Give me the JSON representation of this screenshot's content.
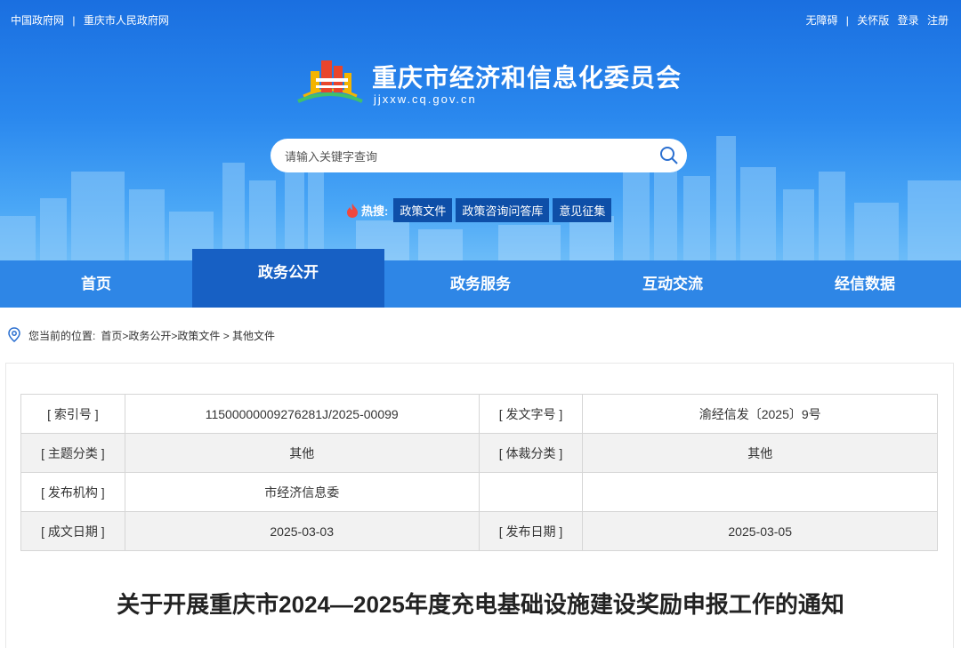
{
  "top": {
    "links": [
      "中国政府网",
      "重庆市人民政府网"
    ],
    "right_links": [
      "无障碍",
      "关怀版",
      "登录",
      "注册"
    ]
  },
  "header": {
    "title": "重庆市经济和信息化委员会",
    "url": "jjxxw.cq.gov.cn"
  },
  "search": {
    "placeholder": "请输入关键字查询",
    "icon": "search-icon"
  },
  "hot": {
    "label": "热搜:",
    "tags": [
      "政策文件",
      "政策咨询问答库",
      "意见征集"
    ]
  },
  "nav": {
    "items": [
      "首页",
      "政务公开",
      "政务服务",
      "互动交流",
      "经信数据"
    ],
    "active": "政务公开"
  },
  "breadcrumb": {
    "prefix": "您当前的位置:",
    "path": "首页>政务公开>政策文件 > 其他文件"
  },
  "meta_table": {
    "rows": [
      [
        "[ 索引号 ]",
        "11500000009276281J/2025-00099",
        "[ 发文字号 ]",
        "渝经信发〔2025〕9号"
      ],
      [
        "[ 主题分类 ]",
        "其他",
        "[ 体裁分类 ]",
        "其他"
      ],
      [
        "[ 发布机构 ]",
        "市经济信息委",
        "",
        ""
      ],
      [
        "[ 成文日期 ]",
        "2025-03-03",
        "[ 发布日期 ]",
        "2025-03-05"
      ]
    ]
  },
  "document": {
    "title": "关于开展重庆市2024—2025年度充电基础设施建设奖励申报工作的通知"
  },
  "colors": {
    "banner": "#2a88ee",
    "nav": "#2e86e6",
    "nav_active": "#1760c4",
    "hot_tag": "#0e4fa8"
  }
}
